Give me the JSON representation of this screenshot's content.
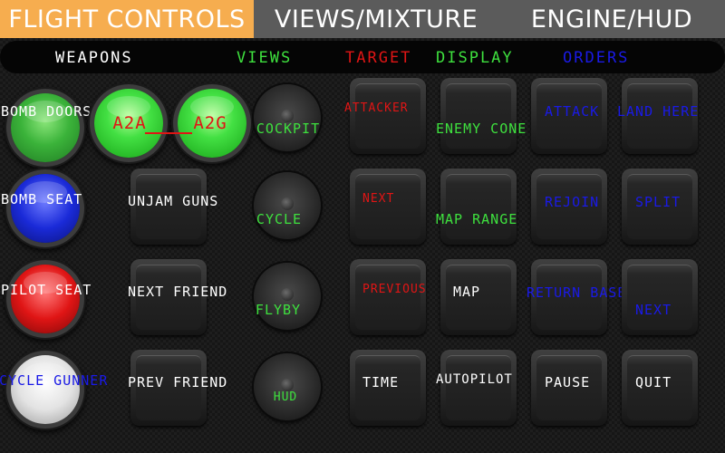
{
  "tabs": [
    {
      "label": "FLIGHT CONTROLS",
      "active": true
    },
    {
      "label": "VIEWS/MIXTURE",
      "active": false
    },
    {
      "label": "ENGINE/HUD",
      "active": false
    }
  ],
  "sections": {
    "weapons": "WEAPONS",
    "views": "VIEWS",
    "target": "TARGET",
    "display": "DISPLAY",
    "orders": "ORDERS"
  },
  "weapons": {
    "bomb_doors": "BOMB DOORS",
    "a2a": "A2A",
    "a2g": "A2G",
    "bomb_seat": "BOMB SEAT",
    "pilot_seat": "PILOT SEAT",
    "cycle_gunner": "CYCLE GUNNER",
    "unjam_guns": "UNJAM GUNS",
    "next_friend": "NEXT FRIEND",
    "prev_friend": "PREV FRIEND"
  },
  "views": {
    "cockpit": "COCKPIT",
    "cycle": "CYCLE",
    "flyby": "FLYBY",
    "hud": "HUD"
  },
  "target": {
    "attacker": "ATTACKER",
    "next": "NEXT",
    "previous": "PREVIOUS"
  },
  "display": {
    "enemy_cone": "ENEMY CONE",
    "map_range": "MAP RANGE",
    "map": "MAP"
  },
  "orders": {
    "attack": "ATTACK",
    "land_here": "LAND HERE",
    "rejoin": "REJOIN",
    "split": "SPLIT",
    "return_base": "RETURN BASE",
    "next": "NEXT"
  },
  "misc": {
    "time": "TIME",
    "autopilot": "AUTOPILOT",
    "pause": "PAUSE",
    "quit": "QUIT"
  },
  "colors": {
    "active_tab": "#f6ad4f",
    "tab_bg": "#5b5b5b",
    "white_label": "#ffffff",
    "green_label": "#3ee03e",
    "red_label": "#e01515",
    "blue_label": "#1a1ae6"
  }
}
